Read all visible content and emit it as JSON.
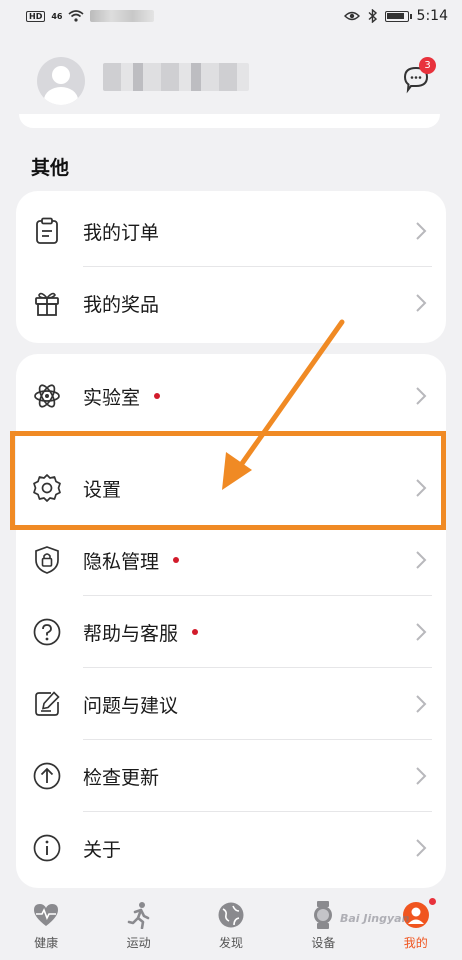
{
  "status_bar": {
    "hd": "HD",
    "signal": "46",
    "time": "5:14",
    "battery_level": 0.9
  },
  "profile": {
    "message_count": "3"
  },
  "section": {
    "title": "其他"
  },
  "menu_group_1": [
    {
      "label": "我的订单",
      "icon": "clipboard-icon"
    },
    {
      "label": "我的奖品",
      "icon": "gift-icon"
    }
  ],
  "menu_group_2": [
    {
      "label": "实验室",
      "icon": "atom-icon",
      "dot": true
    },
    {
      "label": "设置",
      "icon": "gear-icon",
      "dot": false
    },
    {
      "label": "隐私管理",
      "icon": "privacy-lock-icon",
      "dot": true
    },
    {
      "label": "帮助与客服",
      "icon": "help-icon",
      "dot": true
    },
    {
      "label": "问题与建议",
      "icon": "feedback-icon",
      "dot": false
    },
    {
      "label": "检查更新",
      "icon": "update-icon",
      "dot": false
    },
    {
      "label": "关于",
      "icon": "info-icon",
      "dot": false
    }
  ],
  "bottom_nav": [
    {
      "label": "健康",
      "icon": "health-icon"
    },
    {
      "label": "运动",
      "icon": "running-icon"
    },
    {
      "label": "发现",
      "icon": "discover-icon"
    },
    {
      "label": "设备",
      "icon": "watch-icon"
    },
    {
      "label": "我的",
      "icon": "profile-icon",
      "active": true
    }
  ],
  "watermark": "Bai Jingyan",
  "colors": {
    "accent": "#f0551f",
    "highlight": "#f08a24",
    "badge": "#e8323c",
    "dot": "#d21b2b"
  }
}
